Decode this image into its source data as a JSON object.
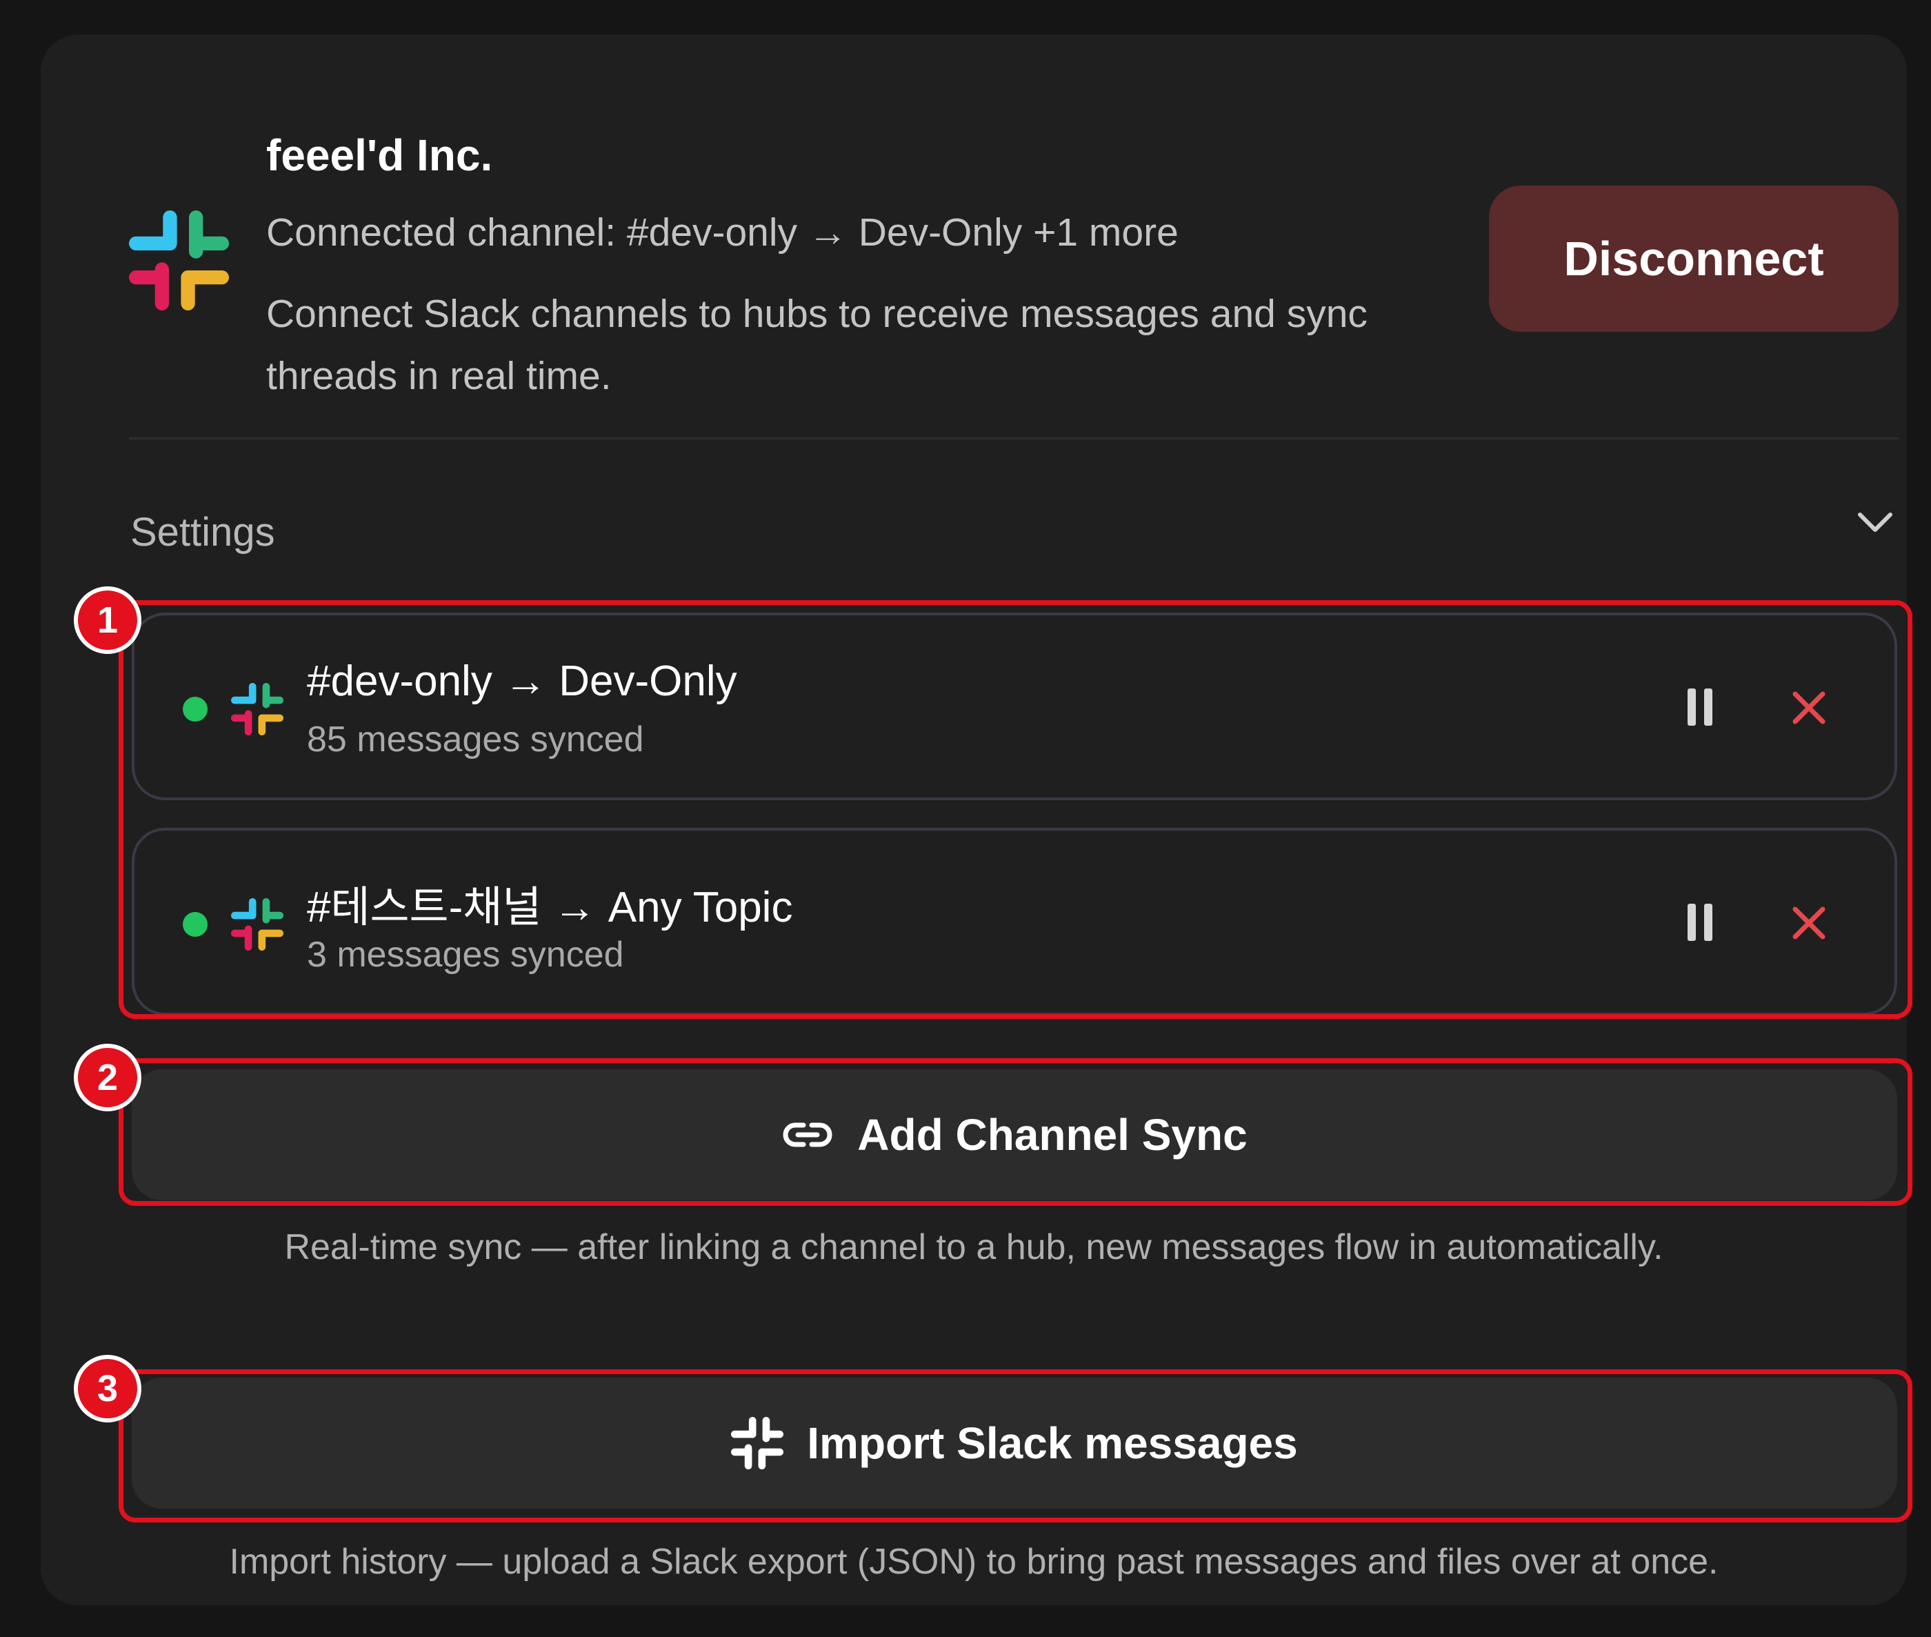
{
  "header": {
    "workspace_name": "feeel'd Inc.",
    "connected_line": "Connected channel: #dev-only → Dev-Only +1 more",
    "description": "Connect Slack channels to hubs to receive messages and sync threads in real time.",
    "disconnect_label": "Disconnect",
    "logo_icon": "slack-icon"
  },
  "settings": {
    "label": "Settings",
    "toggle_icon": "chevron-down-icon"
  },
  "channels": [
    {
      "title": "#dev-only → Dev-Only",
      "status_text": "85 messages synced",
      "status_color": "#22c55e",
      "pause_icon": "pause-icon",
      "remove_icon": "close-icon"
    },
    {
      "title": "#테스트-채널 → Any Topic",
      "status_text": "3 messages synced",
      "status_color": "#22c55e",
      "pause_icon": "pause-icon",
      "remove_icon": "close-icon"
    }
  ],
  "add_sync": {
    "label": "Add Channel Sync",
    "icon": "link-icon",
    "hint": "Real-time sync — after linking a channel to a hub, new messages flow in automatically."
  },
  "import": {
    "label": "Import Slack messages",
    "icon": "slack-icon",
    "hint": "Import history — upload a Slack export (JSON) to bring past messages and files over at once."
  },
  "annotations": {
    "badge_1": "1",
    "badge_2": "2",
    "badge_3": "3",
    "color": "#e3101e"
  },
  "colors": {
    "disconnect_bg": "#5b2a2b",
    "remove_x": "#e5484d",
    "slack_blue": "#36c5f0",
    "slack_green": "#2eb67d",
    "slack_red": "#e01e5a",
    "slack_yellow": "#ecb22e"
  }
}
